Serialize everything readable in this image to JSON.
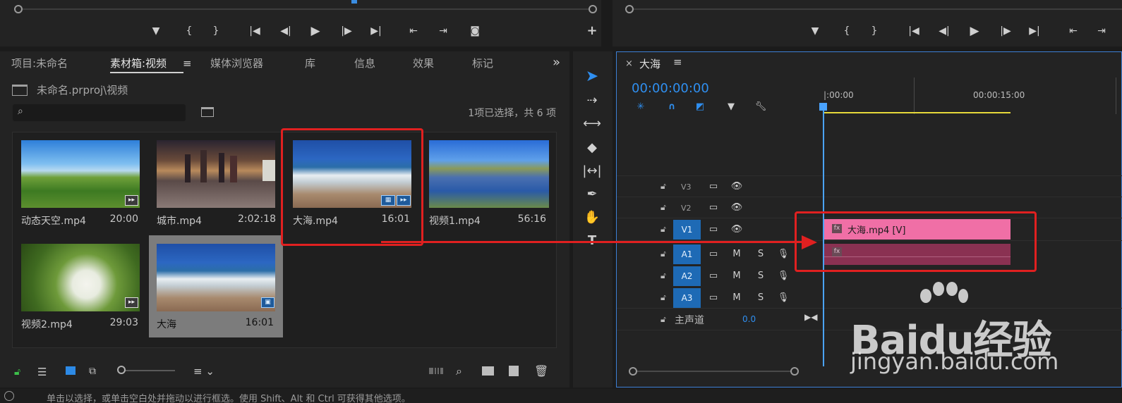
{
  "left_monitor": {
    "controls": [
      "▼",
      "{",
      "}",
      "|◀",
      "◀|",
      "▶",
      "|▶",
      "▶|",
      "⇤",
      "⇥",
      "◙"
    ],
    "add": "+"
  },
  "right_monitor": {
    "controls": [
      "▼",
      "{",
      "}",
      "|◀",
      "◀|",
      "▶",
      "|▶",
      "▶|",
      "⇤",
      "⇥"
    ]
  },
  "project_panel": {
    "tabs": [
      "项目:未命名",
      "素材箱:视频",
      "媒体浏览器",
      "库",
      "信息",
      "效果",
      "标记"
    ],
    "active_tab": "素材箱:视频",
    "menu_icon": "≡",
    "overflow": "»",
    "path": "未命名.prproj\\视频",
    "search_placeholder": "",
    "selection_status": "1项已选择，共 6 项",
    "items": [
      {
        "name": "动态天空.mp4",
        "duration": "20:00",
        "badge": "audio"
      },
      {
        "name": "城市.mp4",
        "duration": "2:02:18",
        "badge": ""
      },
      {
        "name": "大海.mp4",
        "duration": "16:01",
        "badge": "video-audio",
        "selected_box": true
      },
      {
        "name": "视频1.mp4",
        "duration": "56:16",
        "badge": ""
      },
      {
        "name": "视频2.mp4",
        "duration": "29:03",
        "badge": "audio"
      },
      {
        "name": "大海",
        "duration": "16:01",
        "badge": "sequence",
        "highlighted": true
      }
    ]
  },
  "timeline": {
    "sequence_name": "大海",
    "close": "×",
    "menu_icon": "≡",
    "timecode": "00:00:00:00",
    "ruler": [
      "|:00:00",
      "00:00:15:00"
    ],
    "tracks": [
      {
        "id": "V3",
        "targeted": false,
        "kind": "video"
      },
      {
        "id": "V2",
        "targeted": false,
        "kind": "video"
      },
      {
        "id": "V1",
        "targeted": true,
        "kind": "video"
      },
      {
        "id": "A1",
        "targeted": true,
        "kind": "audio"
      },
      {
        "id": "A2",
        "targeted": true,
        "kind": "audio"
      },
      {
        "id": "A3",
        "targeted": true,
        "kind": "audio"
      }
    ],
    "master_label": "主声道",
    "master_value": "0.0",
    "mute": "M",
    "solo": "S",
    "fx": "fx",
    "clip_video_label": "大海.mp4 [V]",
    "colors": {
      "clip_video": "#f06fa6",
      "clip_audio": "#8a3152",
      "playhead": "#4aa3ff",
      "annotation": "#e02020"
    }
  },
  "watermark": {
    "brand": "Baidu经验",
    "url": "jingyan.baidu.com"
  },
  "status_bar": {
    "text": "单击以选择，或单击空白处并拖动以进行框选。使用 Shift、Alt 和 Ctrl 可获得其他选项。"
  }
}
